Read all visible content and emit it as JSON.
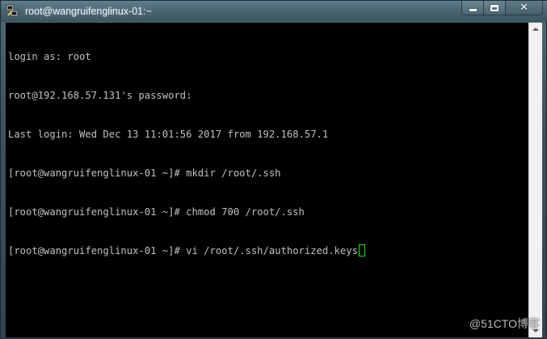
{
  "window": {
    "title": "root@wangruifenglinux-01:~",
    "close_label": "✕"
  },
  "terminal": {
    "lines": [
      "login as: root",
      "root@192.168.57.131's password:",
      "Last login: Wed Dec 13 11:01:56 2017 from 192.168.57.1",
      "[root@wangruifenglinux-01 ~]# mkdir /root/.ssh",
      "[root@wangruifenglinux-01 ~]# chmod 700 /root/.ssh",
      "[root@wangruifenglinux-01 ~]# vi /root/.ssh/authorized.keys"
    ],
    "cursor_color": "#19e619",
    "text_color": "#c0c0c0",
    "background": "#000000"
  },
  "icons": {
    "app": "putty-icon",
    "minimize": "minimize-icon",
    "maximize": "maximize-icon",
    "close": "close-icon",
    "scroll_up": "scroll-up-arrow-icon",
    "scroll_down": "scroll-down-arrow-icon"
  },
  "watermark": "@51CTO博客"
}
